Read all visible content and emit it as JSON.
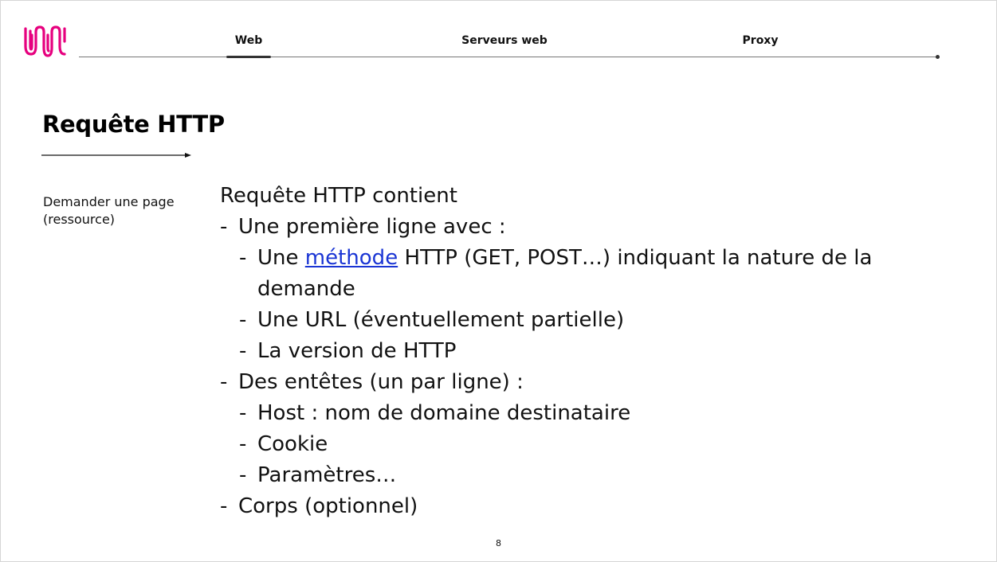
{
  "header": {
    "logo_name": "brand-logo",
    "tabs": [
      {
        "label": "Web",
        "active": true
      },
      {
        "label": "Serveurs web",
        "active": false
      },
      {
        "label": "Proxy",
        "active": false
      }
    ],
    "brand_color": "#e6007e"
  },
  "slide": {
    "title": "Requête HTTP",
    "side_note": "Demander une page (ressource)",
    "intro": "Requête HTTP contient",
    "items": [
      {
        "level": 1,
        "text": "Une première ligne avec :"
      },
      {
        "level": 2,
        "before": "Une ",
        "link": "méthode",
        "after": " HTTP (GET, POST…) indiquant la nature de la",
        "continuation": "demande"
      },
      {
        "level": 2,
        "text": "Une URL (éventuellement partielle)"
      },
      {
        "level": 2,
        "text": "La version de HTTP"
      },
      {
        "level": 1,
        "text": "Des entêtes (un par ligne) :"
      },
      {
        "level": 2,
        "text": "Host : nom de domaine destinataire"
      },
      {
        "level": 2,
        "text": "Cookie"
      },
      {
        "level": 2,
        "text": "Paramètres…"
      },
      {
        "level": 1,
        "text": "Corps (optionnel)"
      }
    ],
    "bullet": "-",
    "link_color": "#1a35d4",
    "page_number": "8"
  }
}
